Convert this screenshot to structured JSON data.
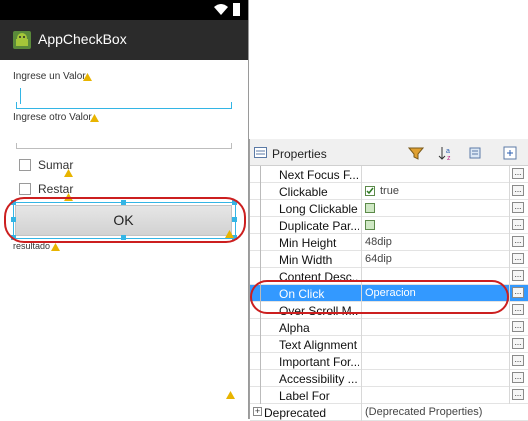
{
  "device": {
    "app_title": "AppCheckBox",
    "label1": "Ingrese un Valor",
    "label2": "Ingrese otro Valor",
    "cb1": "Sumar",
    "cb2": "Restar",
    "ok_button": "OK",
    "result_label": "resultado"
  },
  "properties": {
    "title": "Properties",
    "rows": [
      {
        "name": "Next Focus F...",
        "value": ""
      },
      {
        "name": "Clickable",
        "value": "true"
      },
      {
        "name": "Long Clickable",
        "value": ""
      },
      {
        "name": "Duplicate Par...",
        "value": ""
      },
      {
        "name": "Min Height",
        "value": "48dip"
      },
      {
        "name": "Min Width",
        "value": "64dip"
      },
      {
        "name": "Content Desc...",
        "value": ""
      },
      {
        "name": "On Click",
        "value": "Operacion"
      },
      {
        "name": "Over Scroll M...",
        "value": ""
      },
      {
        "name": "Alpha",
        "value": ""
      },
      {
        "name": "Text Alignment",
        "value": ""
      },
      {
        "name": "Important For...",
        "value": ""
      },
      {
        "name": "Accessibility ...",
        "value": ""
      },
      {
        "name": "Label For",
        "value": ""
      },
      {
        "name": "Deprecated",
        "value": "(Deprecated Properties)"
      }
    ],
    "more_button": "..."
  },
  "icons": [
    "wifi-icon",
    "battery-icon",
    "android-icon",
    "warning-icon",
    "properties-icon",
    "filter-icon",
    "sort-icon",
    "restore-icon",
    "expand-icon"
  ],
  "colors": {
    "highlight": "#3399ff",
    "annotation": "#cc1f1f",
    "focus": "#33b5e5"
  }
}
